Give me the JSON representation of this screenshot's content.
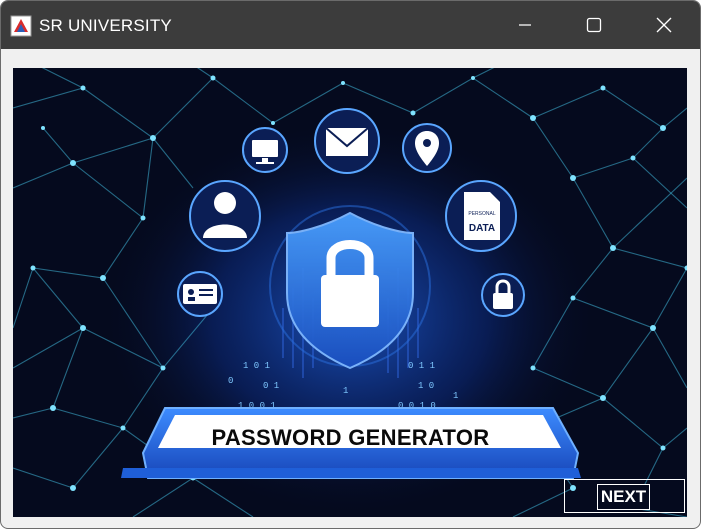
{
  "window": {
    "title": "SR UNIVERSITY",
    "controls": [
      "minimize",
      "maximize",
      "close"
    ]
  },
  "main": {
    "banner_text": "PASSWORD GENERATOR",
    "next_label": "NEXT",
    "illustration_icons": [
      "monitor-icon",
      "mail-icon",
      "location-pin-icon",
      "user-icon",
      "personal-data-document-icon",
      "id-card-icon",
      "small-lock-icon",
      "shield-lock-icon",
      "tablet-icon"
    ],
    "document_icon_text": [
      "PERSONAL",
      "DATA"
    ]
  },
  "colors": {
    "titlebar": "#3c3c3c",
    "window_bg": "#f0f0f0",
    "panel_bg": "#050a1e",
    "network_lines": "#3fb7d9",
    "shield_blue": "#2f7fe6",
    "tablet_blue": "#2a6fe0"
  }
}
